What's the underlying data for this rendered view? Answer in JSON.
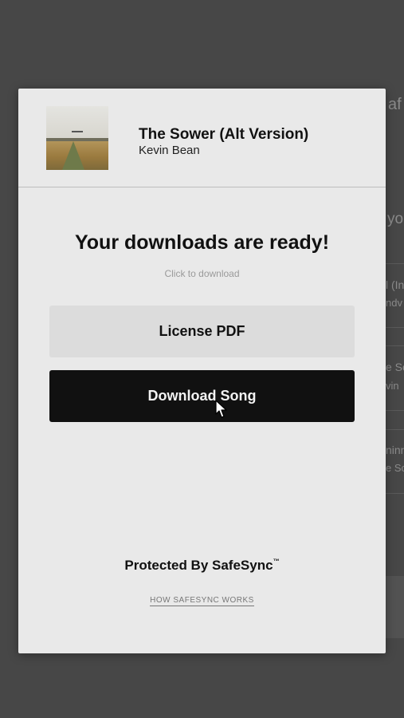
{
  "background": {
    "fragments": [
      "af",
      "yo",
      "l (In",
      "ndv",
      "e So",
      "vin",
      "ninn",
      "e Sc"
    ]
  },
  "song": {
    "title": "The Sower (Alt Version)",
    "artist": "Kevin Bean"
  },
  "main": {
    "headline": "Your downloads are ready!",
    "subtext": "Click to download",
    "license_button": "License PDF",
    "download_button": "Download Song"
  },
  "footer": {
    "protected_text": "Protected By SafeSync",
    "trademark": "™",
    "how_link": "HOW SAFESYNC WORKS"
  },
  "colors": {
    "overlay": "#3d3d3d",
    "modal_bg": "#e9e9e9",
    "primary_button": "#111111",
    "secondary_button": "#dcdcdc"
  },
  "icons": [
    "album-cover-image",
    "mouse-pointer-icon"
  ]
}
